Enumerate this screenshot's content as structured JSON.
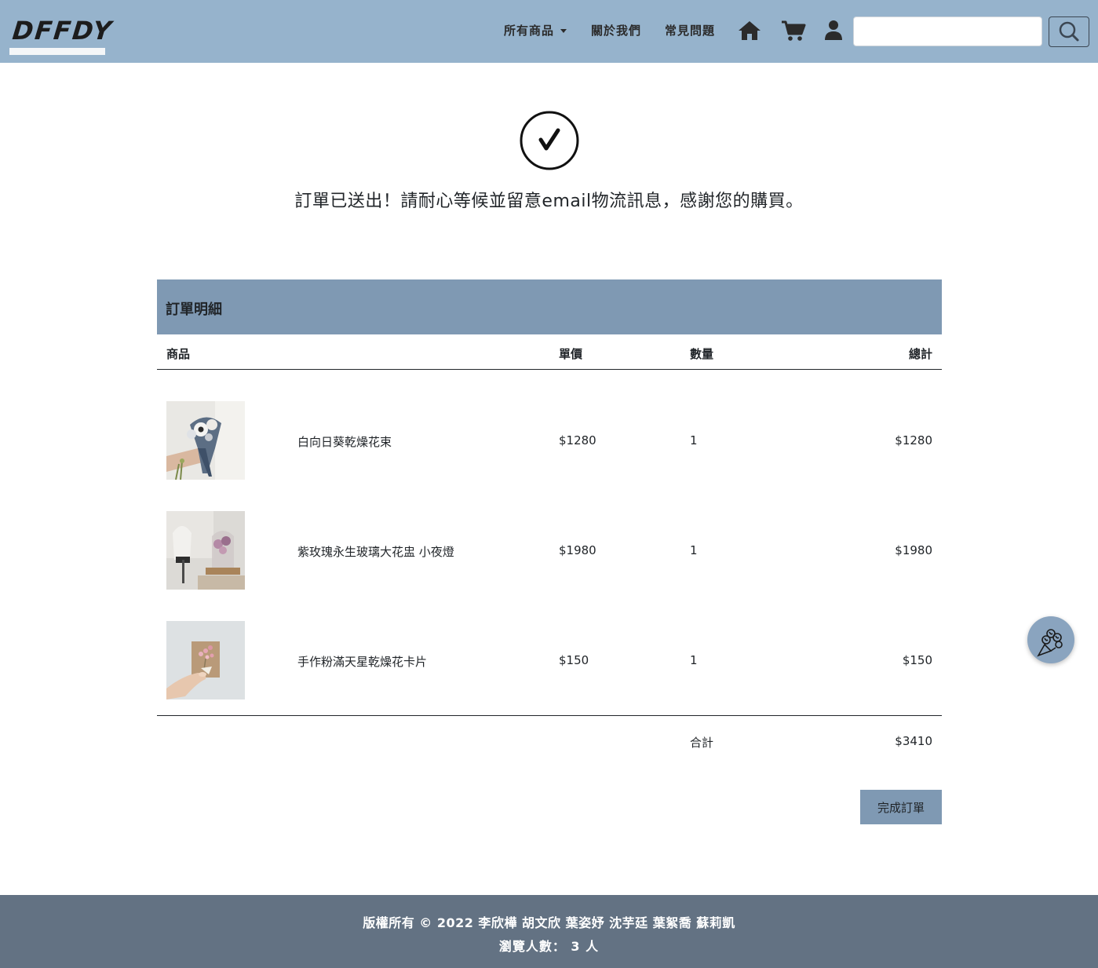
{
  "navbar": {
    "brand": "DFFDY",
    "links": {
      "all_products": "所有商品",
      "about": "關於我們",
      "faq": "常見問題"
    },
    "icons": [
      "home-icon",
      "cart-icon",
      "user-icon",
      "search-icon"
    ],
    "search": {
      "value": "",
      "placeholder": ""
    },
    "background": "#96b3cc"
  },
  "hero": {
    "message": "訂單已送出！請耐心等候並留意email物流訊息，感謝您的購買。"
  },
  "order": {
    "title": "訂單明細",
    "columns": {
      "product": "商品",
      "unit_price": "單價",
      "quantity": "數量",
      "total": "總計"
    },
    "items": [
      {
        "name": "白向日葵乾燥花束",
        "unit_price": "$1280",
        "quantity": "1",
        "total": "$1280"
      },
      {
        "name": "紫玫瑰永生玻璃大花盅 小夜燈",
        "unit_price": "$1980",
        "quantity": "1",
        "total": "$1980"
      },
      {
        "name": "手作粉滿天星乾燥花卡片",
        "unit_price": "$150",
        "quantity": "1",
        "total": "$150"
      }
    ],
    "sum_label": "合計",
    "sum_value": "$3410",
    "complete_button": "完成訂單",
    "accent": "#7f99b3"
  },
  "float_button": {
    "icon": "bouquet-icon"
  },
  "footer": {
    "copyright": "版權所有 © 2022 李欣樺 胡文欣 葉姿妤 沈芋廷 葉絮喬 蘇莉凱",
    "visitors": "瀏覽人數： 3 人",
    "background": "#637283"
  }
}
